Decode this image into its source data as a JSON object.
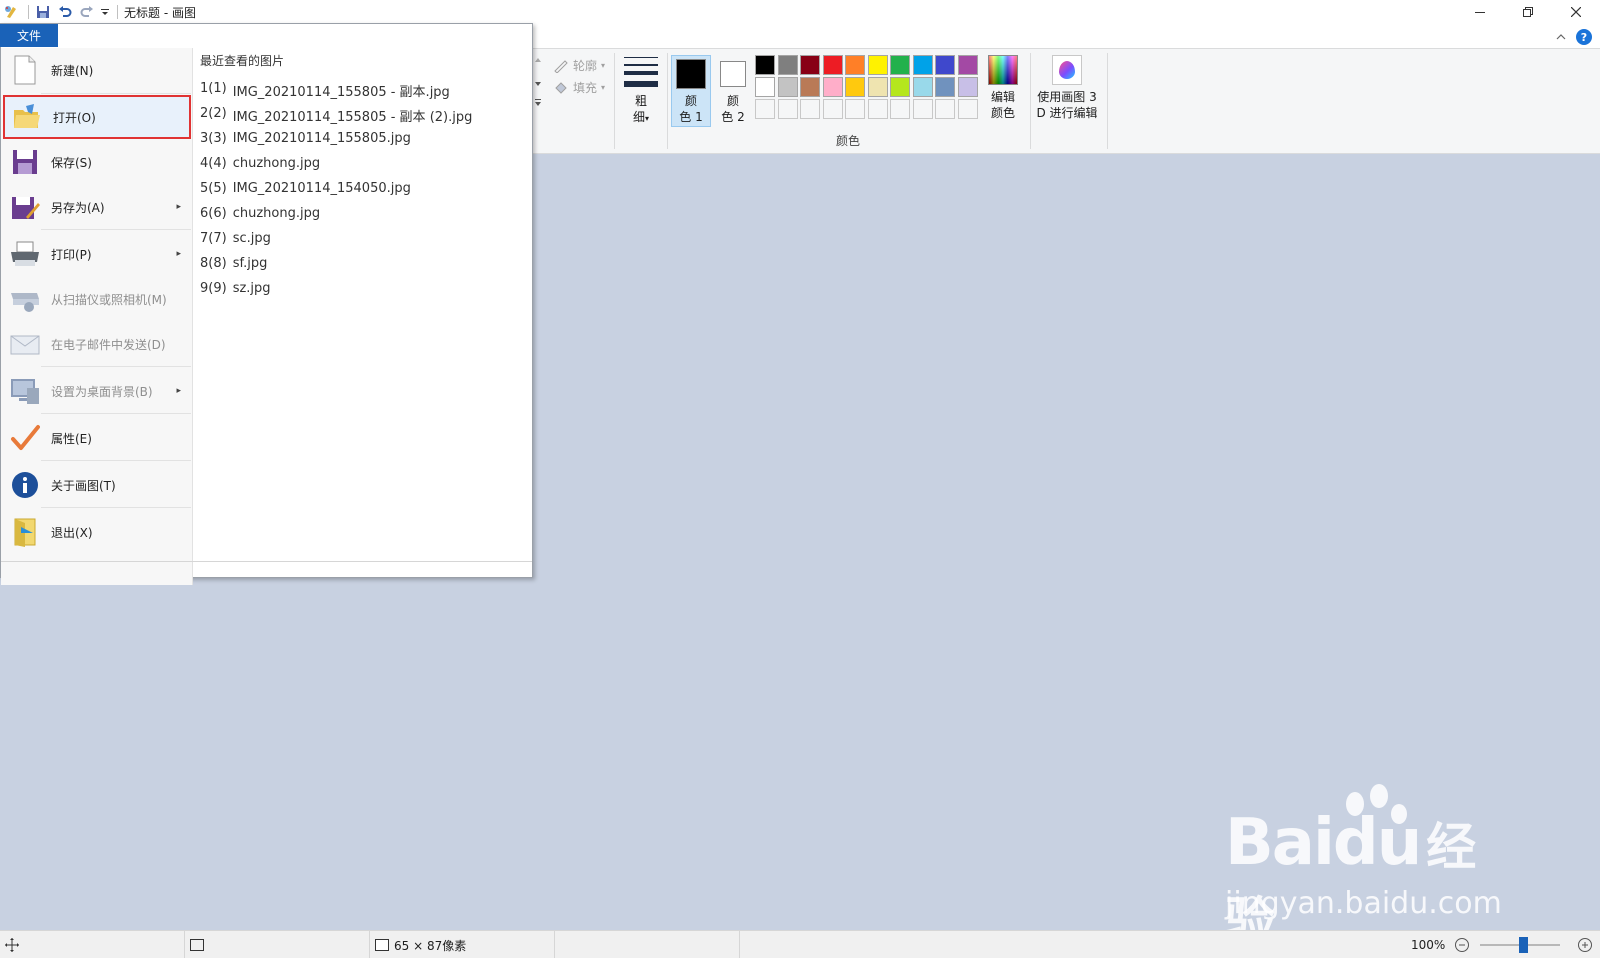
{
  "window": {
    "title": "无标题 - 画图",
    "controls": [
      "minimize",
      "restore",
      "close"
    ]
  },
  "quick_access": [
    "save-icon",
    "undo-icon",
    "redo-icon",
    "customize-icon"
  ],
  "file_tab": {
    "label": "文件"
  },
  "file_menu": {
    "items": [
      {
        "label": "新建(N)",
        "icon": "new-file-icon",
        "disabled": false,
        "submenu": false
      },
      {
        "label": "打开(O)",
        "icon": "open-folder-icon",
        "disabled": false,
        "submenu": false,
        "selected": true
      },
      {
        "label": "保存(S)",
        "icon": "save-disk-icon",
        "disabled": false,
        "submenu": false
      },
      {
        "label": "另存为(A)",
        "icon": "save-as-icon",
        "disabled": false,
        "submenu": true
      },
      {
        "label": "打印(P)",
        "icon": "printer-icon",
        "disabled": false,
        "submenu": true
      },
      {
        "label": "从扫描仪或照相机(M)",
        "icon": "scanner-icon",
        "disabled": true,
        "submenu": false
      },
      {
        "label": "在电子邮件中发送(D)",
        "icon": "email-icon",
        "disabled": true,
        "submenu": false
      },
      {
        "label": "设置为桌面背景(B)",
        "icon": "desktop-icon",
        "disabled": true,
        "submenu": true
      },
      {
        "label": "属性(E)",
        "icon": "checkmark-icon",
        "disabled": false,
        "submenu": false
      },
      {
        "label": "关于画图(T)",
        "icon": "info-icon",
        "disabled": false,
        "submenu": false
      },
      {
        "label": "退出(X)",
        "icon": "exit-icon",
        "disabled": false,
        "submenu": false
      }
    ],
    "recent_title": "最近查看的图片",
    "recent": [
      {
        "num": "1(1)",
        "name": "IMG_20210114_155805 - 副本.jpg"
      },
      {
        "num": "2(2)",
        "name": "IMG_20210114_155805 - 副本 (2).jpg"
      },
      {
        "num": "3(3)",
        "name": "IMG_20210114_155805.jpg"
      },
      {
        "num": "4(4)",
        "name": "chuzhong.jpg"
      },
      {
        "num": "5(5)",
        "name": "IMG_20210114_154050.jpg"
      },
      {
        "num": "6(6)",
        "name": "chuzhong.jpg"
      },
      {
        "num": "7(7)",
        "name": "sc.jpg"
      },
      {
        "num": "8(8)",
        "name": "sf.jpg"
      },
      {
        "num": "9(9)",
        "name": "sz.jpg"
      }
    ]
  },
  "ribbon": {
    "outline_label": "轮廓",
    "fill_label": "填充",
    "thickness_label_1": "粗",
    "thickness_label_2": "细",
    "color1": {
      "line1": "颜",
      "line2": "色 1",
      "value": "#000000"
    },
    "color2": {
      "line1": "颜",
      "line2": "色 2",
      "value": "#ffffff"
    },
    "palette_row1": [
      "#000000",
      "#7f7f7f",
      "#880015",
      "#ed1c24",
      "#ff7f27",
      "#fff200",
      "#22b14c",
      "#00a2e8",
      "#3f48cc",
      "#a349a4"
    ],
    "palette_row2": [
      "#ffffff",
      "#c3c3c3",
      "#b97a57",
      "#ffaec9",
      "#ffc90e",
      "#efe4b0",
      "#b5e61d",
      "#99d9ea",
      "#7092be",
      "#c8bfe7"
    ],
    "edit_colors_1": "编辑",
    "edit_colors_2": "颜色",
    "colors_group": "颜色",
    "paint3d_1": "使用画图 3",
    "paint3d_2": "D 进行编辑"
  },
  "status": {
    "size_text": "65 × 87像素",
    "zoom": "100%"
  },
  "watermark": {
    "logo": "Bai",
    "logo_du": "du",
    "logo_cn": "经验",
    "url": "jingyan.baidu.com"
  },
  "colors": {
    "accent": "#1a62b8",
    "canvas_bg": "#c8d1e1",
    "selection_border": "#e03333"
  }
}
